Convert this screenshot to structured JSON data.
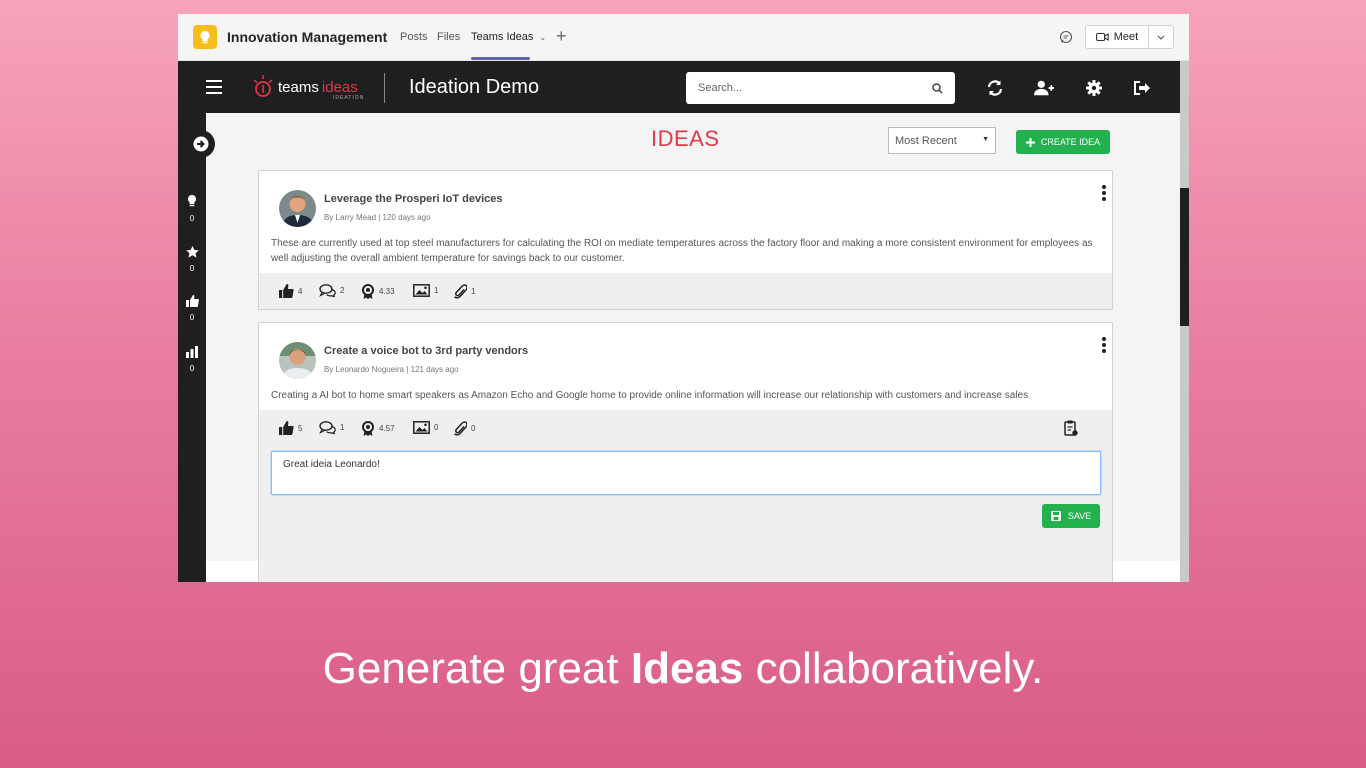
{
  "teams": {
    "app_title": "Innovation Management",
    "tabs": [
      {
        "label": "Posts"
      },
      {
        "label": "Files"
      },
      {
        "label": "Teams Ideas"
      }
    ],
    "meet_label": "Meet",
    "brand_color": "#6264a7"
  },
  "appbar": {
    "logo_text_1": "teams",
    "logo_text_2": "ideas",
    "logo_sub": "IDEATION",
    "app_name": "Ideation Demo",
    "search_placeholder": "Search...",
    "icons": [
      "refresh-icon",
      "add-user-icon",
      "gear-icon",
      "logout-icon"
    ]
  },
  "sidebar": {
    "items": [
      {
        "icon": "lightbulb-icon",
        "count": "0"
      },
      {
        "icon": "star-icon",
        "count": "0"
      },
      {
        "icon": "thumbs-up-icon",
        "count": "0"
      },
      {
        "icon": "bar-chart-icon",
        "count": "0"
      }
    ]
  },
  "main": {
    "title": "IDEAS",
    "sort": {
      "selected": "Most Recent"
    },
    "create_label": "CREATE IDEA",
    "accent_color": "#e23b47",
    "action_color": "#22b14c"
  },
  "ideas": [
    {
      "title": "Leverage the Prosperi IoT devices",
      "meta": "By Larry Mead | 120 days ago",
      "body": "These are currently used at top steel manufacturers for calculating the ROI on mediate temperatures across the factory floor and making a more consistent environment for employees as well adjusting the overall ambient temperature for savings back to our customer.",
      "likes": "4",
      "comments": "2",
      "rating": "4.33",
      "images": "1",
      "attachments": "1"
    },
    {
      "title": "Create a voice bot to 3rd party vendors",
      "meta": "By Leonardo Nogueira | 121 days ago",
      "body": "Creating a AI bot to home smart speakers as Amazon Echo and Google home to provide online information will increase our relationship with customers and increase sales",
      "likes": "5",
      "comments": "1",
      "rating": "4.57",
      "images": "0",
      "attachments": "0",
      "comment_value": "Great ideia Leonardo!",
      "save_label": "SAVE"
    }
  ],
  "caption": {
    "before": "Generate great ",
    "bold": "Ideas",
    "after": " collaboratively."
  }
}
